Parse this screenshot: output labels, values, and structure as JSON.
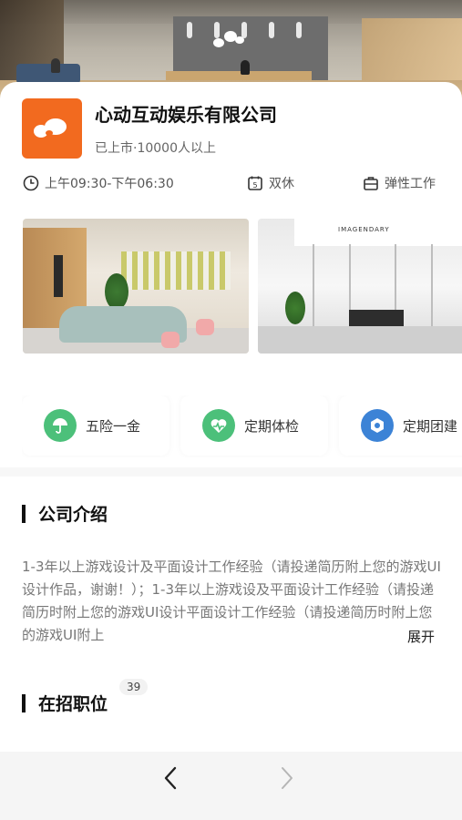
{
  "company": {
    "name": "心动互动娱乐有限公司",
    "meta": "已上市·10000人以上"
  },
  "info": {
    "hours": "上午09:30-下午06:30",
    "rest": "双休",
    "rest_icon_number": "5",
    "flex": "弹性工作"
  },
  "gallery": {
    "photo2_sign": "IMAGENDARY"
  },
  "benefits": [
    {
      "label": "五险一金",
      "icon": "umbrella-icon",
      "color": "#4cc07a"
    },
    {
      "label": "定期体检",
      "icon": "heartbeat-icon",
      "color": "#4cc07a"
    },
    {
      "label": "定期团建",
      "icon": "team-icon",
      "color": "#3c83d6"
    }
  ],
  "intro": {
    "title": "公司介绍",
    "text": "1-3年以上游戏设计及平面设计工作经验（请投递简历附上您的游戏UI设计作品，谢谢！）；1-3年以上游戏设及平面设计工作经验（请投递简历时附上您的游戏UI设计平面设计工作经验（请投递简历时附上您的游戏UI附上",
    "expand": "展开"
  },
  "jobs": {
    "title": "在招职位",
    "count": "39"
  },
  "colors": {
    "brand": "#f26a1f",
    "text_primary": "#111111",
    "text_secondary": "#777777"
  }
}
